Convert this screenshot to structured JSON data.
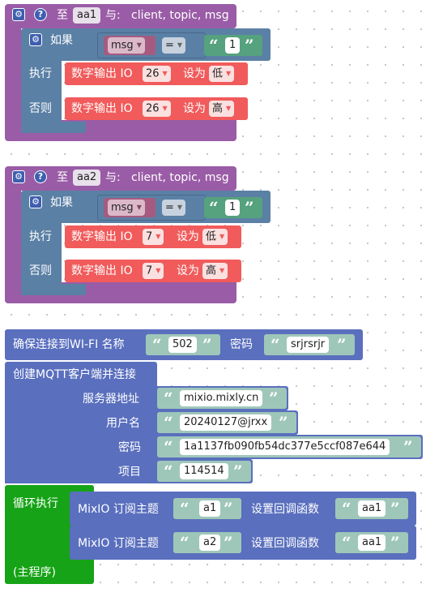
{
  "procs": [
    {
      "to_label": "至",
      "name": "aa1",
      "with_label": "与:",
      "params": "client, topic, msg",
      "if_label": "如果",
      "var": "msg",
      "op": "=",
      "str": "1",
      "do_label": "执行",
      "else_label": "否则",
      "do_stmt": {
        "label": "数字输出 IO",
        "pin": "26",
        "set_label": "设为",
        "value": "低"
      },
      "else_stmt": {
        "label": "数字输出 IO",
        "pin": "26",
        "set_label": "设为",
        "value": "高"
      }
    },
    {
      "to_label": "至",
      "name": "aa2",
      "with_label": "与:",
      "params": "client, topic, msg",
      "if_label": "如果",
      "var": "msg",
      "op": "=",
      "str": "1",
      "do_label": "执行",
      "else_label": "否则",
      "do_stmt": {
        "label": "数字输出 IO",
        "pin": "7",
        "set_label": "设为",
        "value": "低"
      },
      "else_stmt": {
        "label": "数字输出 IO",
        "pin": "7",
        "set_label": "设为",
        "value": "高"
      }
    }
  ],
  "wifi": {
    "label": "确保连接到WI-FI 名称",
    "ssid": "502",
    "pwd_label": "密码",
    "pwd": "srjrsrjr"
  },
  "mqtt": {
    "title": "创建MQTT客户端并连接",
    "rows": [
      {
        "label": "服务器地址",
        "value": "mixio.mixly.cn"
      },
      {
        "label": "用户名",
        "value": "20240127@jrxx"
      },
      {
        "label": "密码",
        "value": "1a1137fb090fb54dc377e5ccf087e644"
      },
      {
        "label": "项目",
        "value": "114514"
      }
    ]
  },
  "loop": {
    "label": "循环执行",
    "footer": "(主程序)",
    "subs": [
      {
        "label": "MixIO 订阅主题",
        "topic": "a1",
        "cb_label": "设置回调函数",
        "cb": "aa1"
      },
      {
        "label": "MixIO 订阅主题",
        "topic": "a2",
        "cb_label": "设置回调函数",
        "cb": "aa1"
      }
    ]
  },
  "icons": {
    "gear": "gear-icon",
    "help": "help-icon",
    "dropdown": "dropdown-arrow-icon",
    "quote": "quote-icon"
  },
  "colors": {
    "procedure": "#9a5ca6",
    "logic": "#5b80a5",
    "io": "#f15b5b",
    "network": "#5a6fbe",
    "loop": "#16a317",
    "text": "#9fc7b9"
  }
}
